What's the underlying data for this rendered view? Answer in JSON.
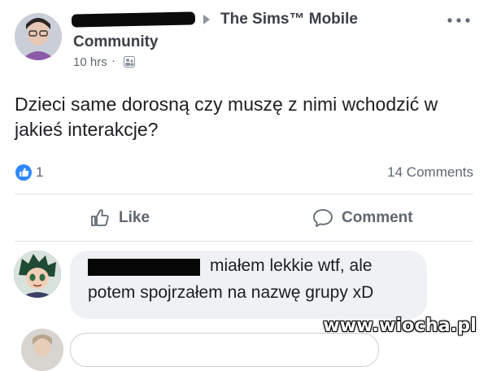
{
  "post": {
    "group_link": "The Sims™ Mobile",
    "group_sub": "Community",
    "time": "10 hrs",
    "dot": "·",
    "text": "Dzieci same dorosną czy muszę z nimi wchodzić w jakieś interakcje?"
  },
  "reactions": {
    "like_count": "1",
    "comments_label": "14 Comments"
  },
  "actions": {
    "like_label": "Like",
    "comment_label": "Comment"
  },
  "comment": {
    "line1": "miałem lekkie wtf, ale",
    "line2": "potem spojrzałem na nazwę grupy xD"
  },
  "watermark": "www.wiocha.pl",
  "colors": {
    "like_blue": "#2d88ff",
    "muted": "#606770",
    "bubble": "#eff1f4"
  }
}
